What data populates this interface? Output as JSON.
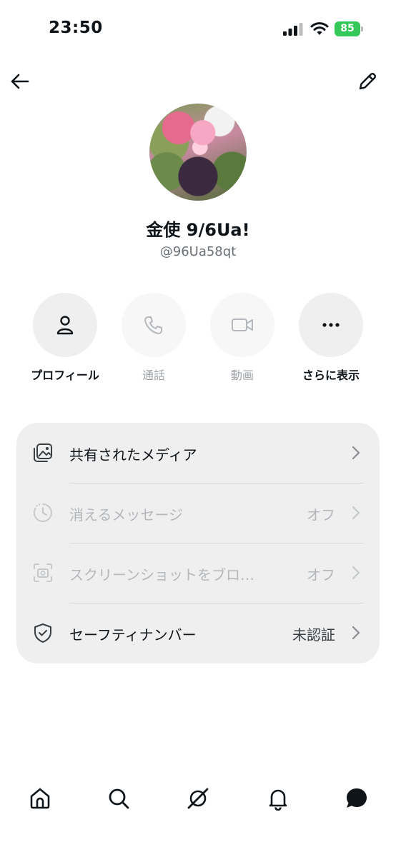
{
  "status": {
    "time": "23:50",
    "battery": "85"
  },
  "profile": {
    "display_name": "金使 9/6Ua!",
    "handle": "@96Ua58qt"
  },
  "actions": [
    {
      "label": "プロフィール",
      "icon": "person-icon",
      "enabled": true
    },
    {
      "label": "通話",
      "icon": "phone-icon",
      "enabled": false
    },
    {
      "label": "動画",
      "icon": "video-icon",
      "enabled": false
    },
    {
      "label": "さらに表示",
      "icon": "more-icon",
      "enabled": true
    }
  ],
  "settings": [
    {
      "label": "共有されたメディア",
      "value": "",
      "icon": "media-icon",
      "enabled": true
    },
    {
      "label": "消えるメッセージ",
      "value": "オフ",
      "icon": "timer-icon",
      "enabled": false
    },
    {
      "label": "スクリーンショットをブロ…",
      "value": "オフ",
      "icon": "screenshot-icon",
      "enabled": false
    },
    {
      "label": "セーフティナンバー",
      "value": "未認証",
      "icon": "shield-icon",
      "enabled": true
    }
  ],
  "nav": [
    "home-icon",
    "search-icon",
    "grok-icon",
    "notifications-icon",
    "messages-icon"
  ],
  "colors": {
    "battery": "#34c759",
    "card": "#efefef",
    "muted": "#6b7075",
    "disabled": "#b4b8bc"
  }
}
